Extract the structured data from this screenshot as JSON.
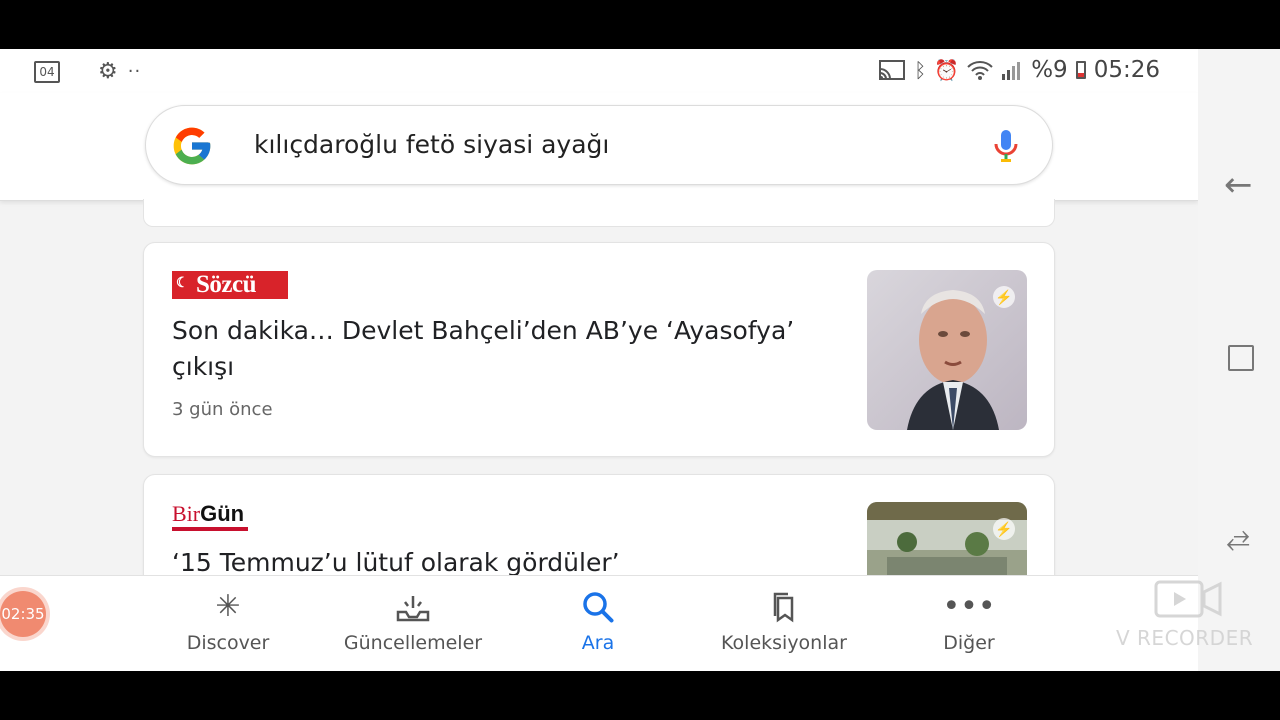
{
  "status_bar": {
    "calendar_day": "04",
    "battery_percent": "%9",
    "time": "05:26"
  },
  "search": {
    "query": "kılıçdaroğlu fetö siyasi ayağı"
  },
  "results": [
    {
      "source": "SÖZCÜ",
      "source_logo": "Sözcü",
      "title": "Son dakika… Devlet Bahçeli’den AB’ye ‘Ayasofya’ çıkışı",
      "time": "3 gün önce"
    },
    {
      "source_logo_bir": "Bir",
      "source_logo_gun": "Gün",
      "title": "‘15 Temmuz’u lütuf olarak gördüler’"
    }
  ],
  "bottom_nav": [
    {
      "label": "Discover",
      "icon": "asterisk-icon",
      "active": false
    },
    {
      "label": "Güncellemeler",
      "icon": "inbox-updates-icon",
      "active": false
    },
    {
      "label": "Ara",
      "icon": "search-icon",
      "active": true
    },
    {
      "label": "Koleksiyonlar",
      "icon": "bookmarks-icon",
      "active": false
    },
    {
      "label": "Diğer",
      "icon": "more-icon",
      "active": false
    }
  ],
  "recorder": {
    "timer": "02:35",
    "watermark": "V RECORDER"
  },
  "colors": {
    "accent": "#1a73e8",
    "sozcu_red": "#d8232a",
    "birgun_red": "#c8102e"
  }
}
